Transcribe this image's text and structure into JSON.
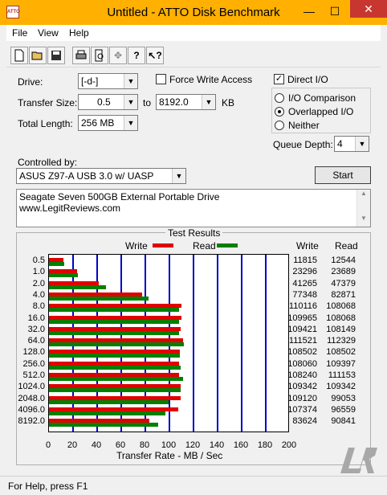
{
  "window": {
    "title": "Untitled - ATTO Disk Benchmark",
    "icon_text": "ATTO",
    "minimize": "—",
    "maximize": "☐",
    "close": "✕"
  },
  "menu": {
    "file": "File",
    "view": "View",
    "help": "Help"
  },
  "toolbar": {
    "icons": [
      "new-icon",
      "open-icon",
      "save-icon",
      "print-icon",
      "print-preview-icon",
      "move-icon",
      "help-icon",
      "context-help-icon"
    ]
  },
  "form": {
    "drive_label": "Drive:",
    "drive_value": "[-d-]",
    "force_write_label": "Force Write Access",
    "force_write_checked": false,
    "direct_io_label": "Direct I/O",
    "direct_io_checked": true,
    "transfer_size_label": "Transfer Size:",
    "transfer_from": "0.5",
    "to_label": "to",
    "transfer_to": "8192.0",
    "kb_label": "KB",
    "total_length_label": "Total Length:",
    "total_length_value": "256 MB",
    "io_comparison_label": "I/O Comparison",
    "overlapped_io_label": "Overlapped I/O",
    "neither_label": "Neither",
    "io_mode_selected": "Overlapped I/O",
    "queue_depth_label": "Queue Depth:",
    "queue_depth_value": "4",
    "controlled_by_label": "Controlled by:",
    "controlled_by_value": "ASUS Z97-A USB 3.0 w/ UASP",
    "start_label": "Start",
    "description_line1": "Seagate Seven 500GB External Portable Drive",
    "description_line2": "www.LegitReviews.com"
  },
  "results": {
    "title": "Test Results",
    "legend_write": "Write",
    "legend_read": "Read",
    "col_write": "Write",
    "col_read": "Read",
    "xlabel": "Transfer Rate - MB / Sec",
    "write_color": "#e00000",
    "read_color": "#008000"
  },
  "chart_data": {
    "type": "bar",
    "orientation": "horizontal",
    "categories": [
      "0.5",
      "1.0",
      "2.0",
      "4.0",
      "8.0",
      "16.0",
      "32.0",
      "64.0",
      "128.0",
      "256.0",
      "512.0",
      "1024.0",
      "2048.0",
      "4096.0",
      "8192.0"
    ],
    "series": [
      {
        "name": "Write",
        "values": [
          11815,
          23296,
          41265,
          77348,
          110116,
          109965,
          109421,
          111521,
          108502,
          108060,
          108240,
          109342,
          109120,
          107374,
          83624
        ]
      },
      {
        "name": "Read",
        "values": [
          12544,
          23689,
          47379,
          82871,
          108068,
          108068,
          108149,
          112329,
          108502,
          109397,
          111153,
          109342,
          99053,
          96559,
          90841
        ]
      }
    ],
    "xlabel": "Transfer Rate - MB / Sec",
    "xlim": [
      0,
      200
    ],
    "xticks": [
      "0",
      "20",
      "40",
      "60",
      "80",
      "100",
      "120",
      "140",
      "160",
      "180",
      "200"
    ],
    "grid": true,
    "legend": "top"
  },
  "status": {
    "text": "For Help, press F1"
  },
  "watermark": "Legit Reviews logo"
}
